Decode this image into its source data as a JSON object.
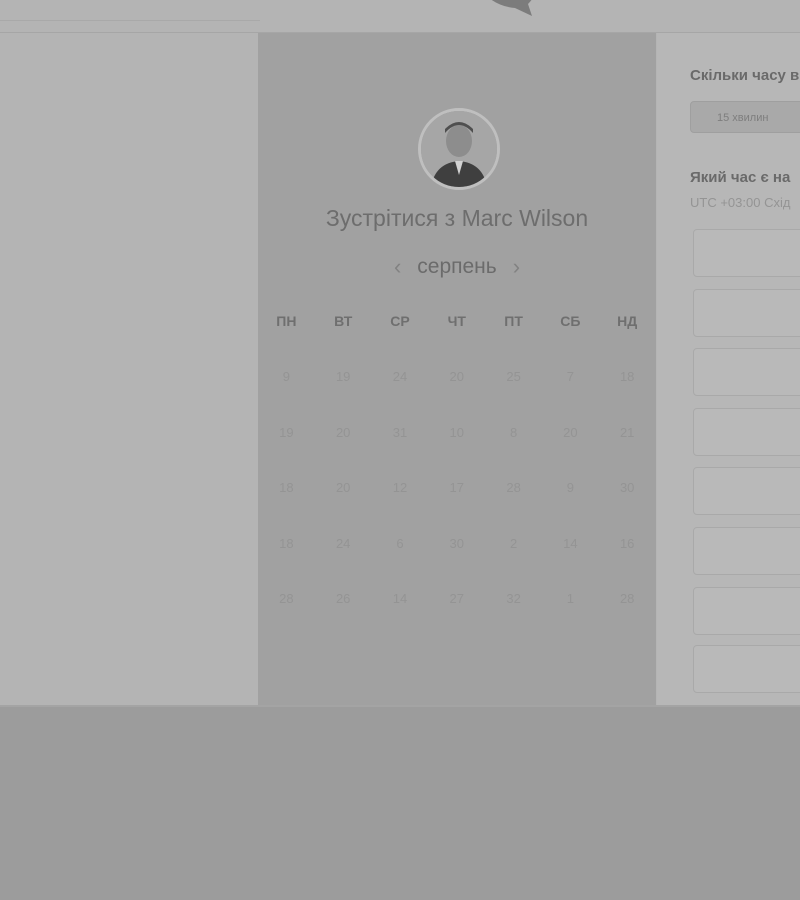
{
  "booking": {
    "title": "Зустрітися з Marc Wilson",
    "month": "серпень",
    "prev_icon": "chevron-left-icon",
    "next_icon": "chevron-right-icon",
    "weekdays": [
      "ПН",
      "ВТ",
      "СР",
      "ЧТ",
      "ПТ",
      "СБ",
      "НД"
    ],
    "weeks": [
      [
        "9",
        "19",
        "24",
        "20",
        "25",
        "7",
        "18"
      ],
      [
        "19",
        "20",
        "31",
        "10",
        "8",
        "20",
        "21"
      ],
      [
        "18",
        "20",
        "12",
        "17",
        "28",
        "9",
        "30"
      ],
      [
        "18",
        "24",
        "6",
        "30",
        "2",
        "14",
        "16"
      ],
      [
        "28",
        "26",
        "14",
        "27",
        "32",
        "1",
        "28"
      ]
    ]
  },
  "side": {
    "duration_question": "Скільки часу в",
    "duration_option": "15 хвилин",
    "time_question": "Який час є на",
    "timezone": "UTC +03:00 Схід"
  }
}
